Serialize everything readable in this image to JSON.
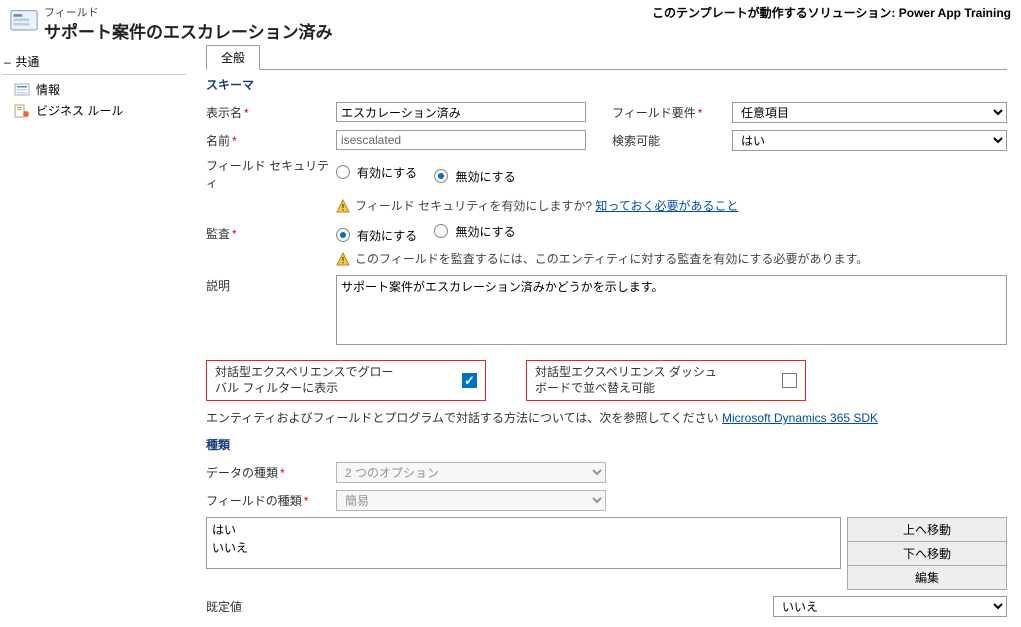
{
  "header": {
    "small": "フィールド",
    "title": "サポート案件のエスカレーション済み",
    "right": "このテンプレートが動作するソリューション: Power App Training"
  },
  "sidebar": {
    "section": "共通",
    "items": [
      "情報",
      "ビジネス ルール"
    ]
  },
  "tabs": {
    "general": "全般"
  },
  "schema": {
    "title": "スキーマ",
    "display_name_label": "表示名",
    "display_name_value": "エスカレーション済み",
    "field_req_label": "フィールド要件",
    "field_req_value": "任意項目",
    "name_label": "名前",
    "name_value": "isescalated",
    "searchable_label": "検索可能",
    "searchable_value": "はい",
    "field_sec_label": "フィールド セキュリティ",
    "enable": "有効にする",
    "disable": "無効にする",
    "sec_warning": "フィールド セキュリティを有効にしますか?",
    "sec_link": "知っておく必要があること",
    "audit_label": "監査",
    "audit_warning": "このフィールドを監査するには、このエンティティに対する監査を有効にする必要があります。",
    "desc_label": "説明",
    "desc_value": "サポート案件がエスカレーション済みかどうかを示します。",
    "global_filter_label": "対話型エクスペリエンスでグローバル フィルターに表示",
    "dashboard_sort_label": "対話型エクスペリエンス ダッシュボードで並べ替え可能",
    "ref_text": "エンティティおよびフィールドとプログラムで対話する方法については、次を参照してください",
    "ref_link": "Microsoft Dynamics 365 SDK"
  },
  "type": {
    "title": "種類",
    "data_type_label": "データの種類",
    "data_type_value": "2 つのオプション",
    "field_type_label": "フィールドの種類",
    "field_type_value": "簡易",
    "options": [
      "はい",
      "いいえ"
    ],
    "move_up": "上へ移動",
    "move_down": "下へ移動",
    "edit": "編集",
    "default_label": "既定値",
    "default_value": "いいえ"
  }
}
